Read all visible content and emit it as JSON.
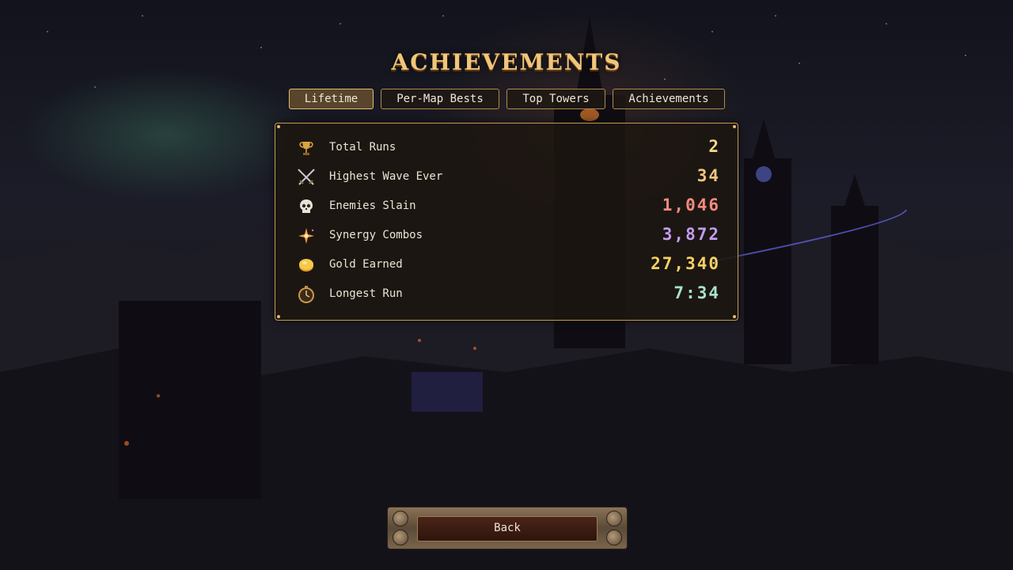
{
  "title": "ACHIEVEMENTS",
  "tabs": [
    {
      "label": "Lifetime",
      "active": true
    },
    {
      "label": "Per-Map Bests",
      "active": false
    },
    {
      "label": "Top Towers",
      "active": false
    },
    {
      "label": "Achievements",
      "active": false
    }
  ],
  "stats": [
    {
      "icon": "trophy-icon",
      "label": "Total Runs",
      "value": "2",
      "color": "#f3d98a"
    },
    {
      "icon": "crossed-swords-icon",
      "label": "Highest Wave Ever",
      "value": "34",
      "color": "#f1c67e"
    },
    {
      "icon": "skull-icon",
      "label": "Enemies Slain",
      "value": "1,046",
      "color": "#f28b7d"
    },
    {
      "icon": "sparkle-icon",
      "label": "Synergy Combos",
      "value": "3,872",
      "color": "#c39cf2"
    },
    {
      "icon": "gold-coin-icon",
      "label": "Gold Earned",
      "value": "27,340",
      "color": "#f4d264"
    },
    {
      "icon": "stopwatch-icon",
      "label": "Longest Run",
      "value": "7:34",
      "color": "#a9e3c6"
    }
  ],
  "back_label": "Back"
}
